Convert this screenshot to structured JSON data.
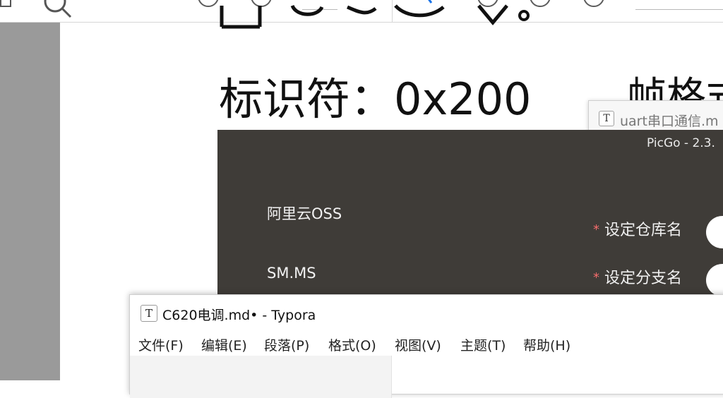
{
  "viewer": {
    "toolbar_icons": [
      "search-icon",
      "circle-button-icon",
      "circle-button-icon",
      "pen-icon",
      "circle-button-icon",
      "circle-button-icon",
      "circle-button-icon"
    ]
  },
  "document": {
    "identifier_line": "标识符：0x200",
    "frame_heading": "帧格式"
  },
  "uart_window": {
    "app_icon": "T",
    "title": "uart串口通信.m"
  },
  "picgo": {
    "title": "PicGo - 2.3.",
    "uploaders": [
      {
        "label": "阿里云OSS"
      },
      {
        "label": "SM.MS"
      }
    ],
    "fields": {
      "required_mark": "*",
      "repo_label": "设定仓库名",
      "branch_label": "设定分支名"
    }
  },
  "typora": {
    "app_icon": "T",
    "title": "C620电调.md• - Typora",
    "menu": [
      {
        "label": "文件(F)"
      },
      {
        "label": "编辑(E)"
      },
      {
        "label": "段落(P)"
      },
      {
        "label": "格式(O)"
      },
      {
        "label": "视图(V)"
      },
      {
        "label": "主题(T)"
      },
      {
        "label": "帮助(H)"
      }
    ]
  }
}
